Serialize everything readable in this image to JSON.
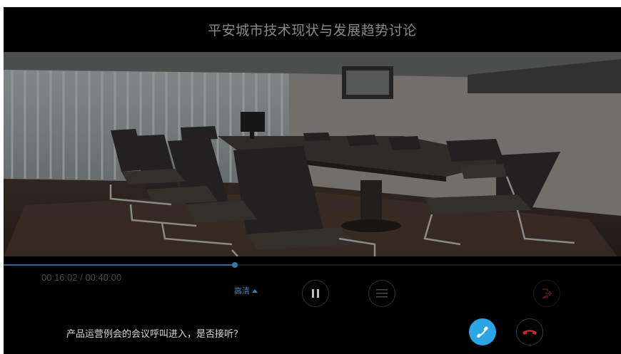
{
  "meeting": {
    "title": "平安城市技术现状与发展趋势讨论"
  },
  "playback": {
    "time_text": "00:16:02 / 00:40:00",
    "progress": 0.3745,
    "quality_label": "高清"
  },
  "incoming": {
    "prompt": "产品运营例会的会议呼叫进入，是否接听？"
  },
  "icons": {
    "pause": "pause-icon",
    "menu": "list-menu-icon",
    "exit": "exit-icon",
    "answer": "phone-answer-icon",
    "hangup": "phone-hangup-icon",
    "quality": "caret-up-icon"
  },
  "colors": {
    "accent": "#2aa6e6",
    "hangup": "#c62828",
    "progress": "#2a6d92"
  }
}
